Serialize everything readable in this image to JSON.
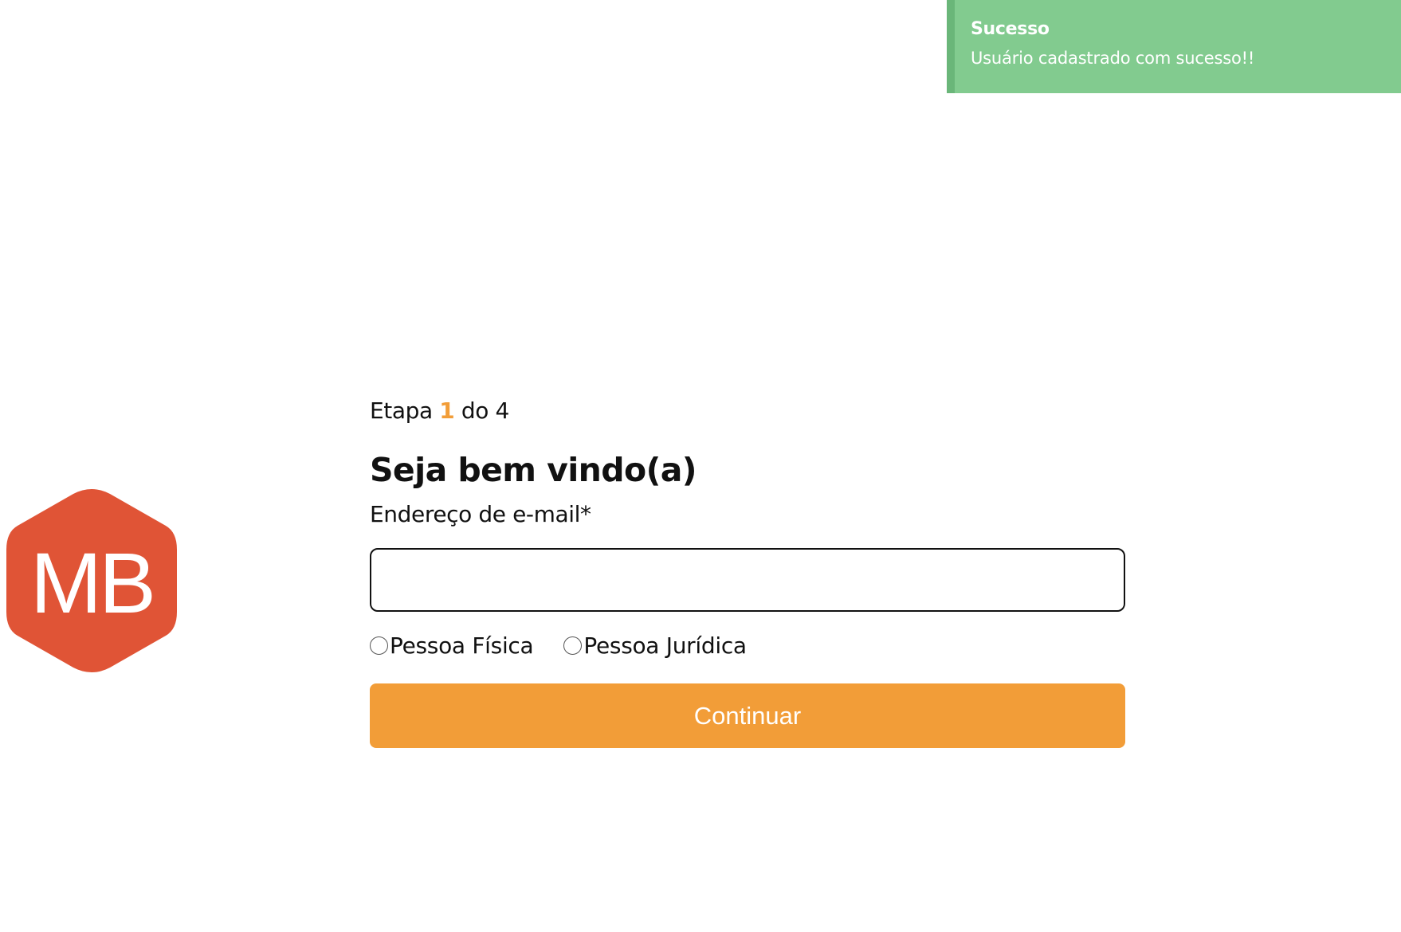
{
  "toast": {
    "title": "Sucesso",
    "message": "Usuário cadastrado com sucesso!!",
    "color": "#82cb8f"
  },
  "logo": {
    "text": "MB",
    "color": "#e05436"
  },
  "form": {
    "step_prefix": "Etapa",
    "step_current": "1",
    "step_suffix": "do 4",
    "heading": "Seja bem vindo(a)",
    "email_label": "Endereço de e-mail*",
    "email_value": "",
    "radio_options": [
      "Pessoa Física",
      "Pessoa Jurídica"
    ],
    "continue_label": "Continuar",
    "accent_color": "#f29d38"
  }
}
